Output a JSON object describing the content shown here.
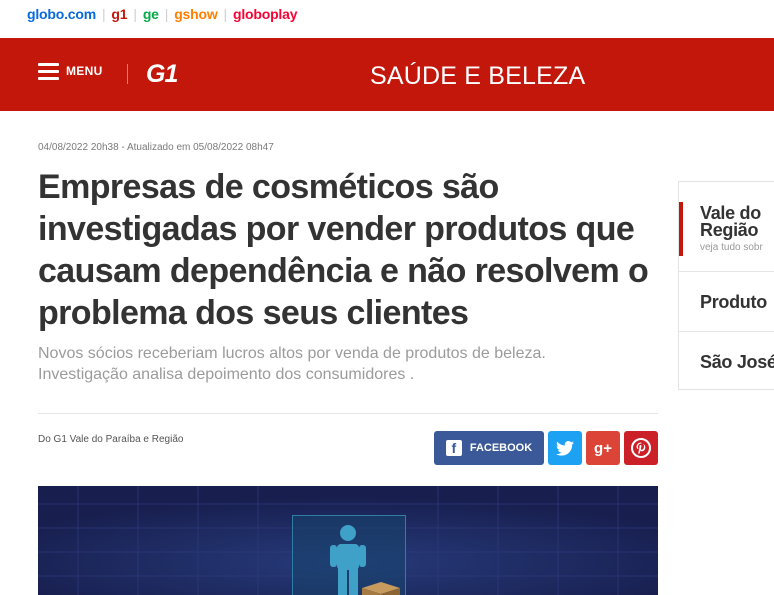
{
  "topbar": {
    "links": [
      "globo.com",
      "g1",
      "ge",
      "gshow",
      "globoplay"
    ]
  },
  "header": {
    "menu_label": "MENU",
    "logo": "G1",
    "section": "SAÚDE E BELEZA"
  },
  "article": {
    "date": "04/08/2022 20h38 - Atualizado em 05/08/2022 08h47",
    "headline": "Empresas de cosméticos são investigadas por vender produtos que causam dependência e não resolvem o problema dos seus clientes",
    "subtitle": "Novos sócios receberiam lucros altos por venda de produtos de beleza. Investigação analisa depoimento dos consumidores .",
    "byline": "Do G1 Vale do Paraíba e Região"
  },
  "share": {
    "facebook_label": "FACEBOOK",
    "facebook_icon": "f",
    "googleplus_icon": "g+"
  },
  "sidebar": {
    "items": [
      {
        "title_line1": "Vale do",
        "title_line2": "Região",
        "sub": "veja tudo sobr"
      },
      {
        "title_line1": "Produto"
      },
      {
        "title_line1": "São José"
      }
    ]
  },
  "colors": {
    "brand_red": "#c4170c",
    "facebook": "#3b5998",
    "twitter": "#1da1f2",
    "googleplus": "#db4437",
    "pinterest": "#cb2027"
  }
}
